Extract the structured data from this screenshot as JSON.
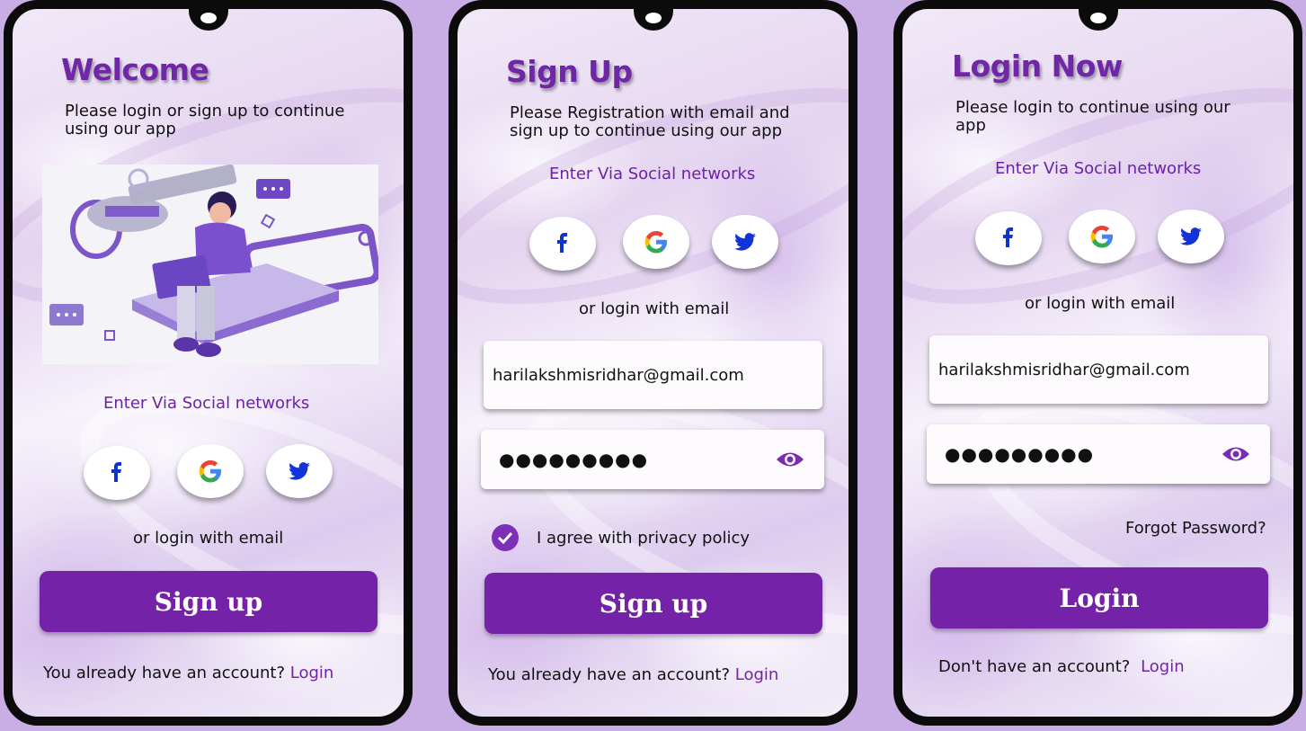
{
  "colors": {
    "background": "#c9aee6",
    "accent": "#7423a8",
    "title": "#6f27a8"
  },
  "screens": {
    "welcome": {
      "title": "Welcome",
      "subtitle_line1": "Please login or sign up to continue",
      "subtitle_line2": "using our app",
      "social_title": "Enter Via Social networks",
      "or_email": "or login with email",
      "button": "Sign up",
      "footer_text": "You already have an account?",
      "footer_link": "Login"
    },
    "signup": {
      "title": "Sign Up",
      "subtitle_line1": "Please Registration with email and",
      "subtitle_line2": "sign up to continue using our app",
      "social_title": "Enter Via Social networks",
      "or_email": "or login with email",
      "email_value": "harilakshmisridhar@gmail.com",
      "password_value": "●●●●●●●●●",
      "agree_text": "I agree with privacy policy",
      "button": "Sign up",
      "footer_text": "You already have an account?",
      "footer_link": "Login"
    },
    "login": {
      "title": "Login Now",
      "subtitle_line1": "Please login to continue using our",
      "subtitle_line2": "app",
      "social_title": "Enter Via Social networks",
      "or_email": "or login with email",
      "email_value": "harilakshmisridhar@gmail.com",
      "password_value": "●●●●●●●●●",
      "forgot": "Forgot Password?",
      "button": "Login",
      "footer_text": "Don't have an account?",
      "footer_link": "Login"
    }
  },
  "icons": [
    "facebook-icon",
    "google-icon",
    "twitter-icon",
    "eye-icon",
    "checkmark-icon"
  ]
}
